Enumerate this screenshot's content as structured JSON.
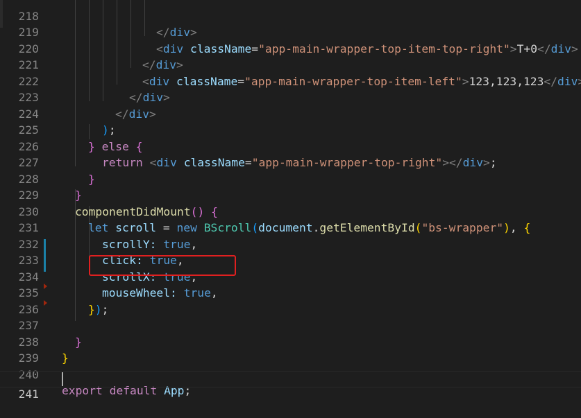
{
  "editor": {
    "lines": [
      {
        "num": "218",
        "tokens": [
          [
            "tok-punct",
            "</"
          ],
          [
            "tok-tag",
            "div"
          ],
          [
            "tok-punct",
            ">"
          ]
        ]
      },
      {
        "num": "219",
        "tokens": [
          [
            "tok-punct",
            "<"
          ],
          [
            "tok-tag",
            "div"
          ],
          [
            "tok-text",
            " "
          ],
          [
            "tok-attr",
            "className"
          ],
          [
            "tok-text",
            "="
          ],
          [
            "tok-str",
            "\"app-main-wrapper-top-item-top-right\""
          ],
          [
            "tok-punct",
            ">"
          ],
          [
            "tok-text",
            "T+0"
          ],
          [
            "tok-punct",
            "</"
          ],
          [
            "tok-tag",
            "div"
          ],
          [
            "tok-punct",
            ">"
          ]
        ]
      },
      {
        "num": "220",
        "tokens": [
          [
            "tok-punct",
            "</"
          ],
          [
            "tok-tag",
            "div"
          ],
          [
            "tok-punct",
            ">"
          ]
        ]
      },
      {
        "num": "221",
        "tokens": [
          [
            "tok-punct",
            "<"
          ],
          [
            "tok-tag",
            "div"
          ],
          [
            "tok-text",
            " "
          ],
          [
            "tok-attr",
            "className"
          ],
          [
            "tok-text",
            "="
          ],
          [
            "tok-str",
            "\"app-main-wrapper-top-item-left\""
          ],
          [
            "tok-punct",
            ">"
          ],
          [
            "tok-text",
            "123,123,123"
          ],
          [
            "tok-punct",
            "</"
          ],
          [
            "tok-tag",
            "div"
          ],
          [
            "tok-punct",
            ">"
          ]
        ]
      },
      {
        "num": "222",
        "tokens": [
          [
            "tok-punct",
            "</"
          ],
          [
            "tok-tag",
            "div"
          ],
          [
            "tok-punct",
            ">"
          ]
        ]
      },
      {
        "num": "223",
        "tokens": [
          [
            "tok-punct",
            "</"
          ],
          [
            "tok-tag",
            "div"
          ],
          [
            "tok-punct",
            ">"
          ]
        ]
      },
      {
        "num": "224",
        "tokens": [
          [
            "tok-br3",
            ")"
          ],
          [
            "tok-text",
            ";"
          ]
        ]
      },
      {
        "num": "225",
        "tokens": [
          [
            "tok-br2",
            "}"
          ],
          [
            "tok-text",
            " "
          ],
          [
            "tok-ctrl",
            "else"
          ],
          [
            "tok-text",
            " "
          ],
          [
            "tok-br2",
            "{"
          ]
        ]
      },
      {
        "num": "226",
        "tokens": [
          [
            "tok-ctrl",
            "return"
          ],
          [
            "tok-text",
            " "
          ],
          [
            "tok-punct",
            "<"
          ],
          [
            "tok-tag",
            "div"
          ],
          [
            "tok-text",
            " "
          ],
          [
            "tok-attr",
            "className"
          ],
          [
            "tok-text",
            "="
          ],
          [
            "tok-str",
            "\"app-main-wrapper-top-right\""
          ],
          [
            "tok-punct",
            "></"
          ],
          [
            "tok-tag",
            "div"
          ],
          [
            "tok-punct",
            ">"
          ],
          [
            "tok-text",
            ";"
          ]
        ]
      },
      {
        "num": "227",
        "tokens": [
          [
            "tok-br2",
            "}"
          ]
        ]
      },
      {
        "num": "228",
        "tokens": [
          [
            "tok-br2",
            "}"
          ]
        ]
      },
      {
        "num": "229",
        "tokens": [
          [
            "tok-fn",
            "componentDidMount"
          ],
          [
            "tok-br2",
            "()"
          ],
          [
            "tok-text",
            " "
          ],
          [
            "tok-br2",
            "{"
          ]
        ]
      },
      {
        "num": "230",
        "tokens": [
          [
            "tok-kw",
            "let"
          ],
          [
            "tok-text",
            " "
          ],
          [
            "tok-var",
            "scroll"
          ],
          [
            "tok-text",
            " = "
          ],
          [
            "tok-kw",
            "new"
          ],
          [
            "tok-text",
            " "
          ],
          [
            "tok-cls",
            "BScroll"
          ],
          [
            "tok-br3",
            "("
          ],
          [
            "tok-var",
            "document"
          ],
          [
            "tok-text",
            "."
          ],
          [
            "tok-fn",
            "getElementById"
          ],
          [
            "tok-br1",
            "("
          ],
          [
            "tok-str",
            "\"bs-wrapper\""
          ],
          [
            "tok-br1",
            ")"
          ],
          [
            "tok-text",
            ", "
          ],
          [
            "tok-br1",
            "{"
          ]
        ]
      },
      {
        "num": "231",
        "tokens": [
          [
            "tok-var",
            "scrollY"
          ],
          [
            "tok-var",
            ":"
          ],
          [
            "tok-text",
            " "
          ],
          [
            "tok-kw",
            "true"
          ],
          [
            "tok-text",
            ","
          ]
        ]
      },
      {
        "num": "232",
        "tokens": [
          [
            "tok-var",
            "click"
          ],
          [
            "tok-var",
            ":"
          ],
          [
            "tok-text",
            " "
          ],
          [
            "tok-kw",
            "true"
          ],
          [
            "tok-text",
            ","
          ]
        ]
      },
      {
        "num": "233",
        "tokens": [
          [
            "tok-var",
            "scrollX"
          ],
          [
            "tok-var",
            ":"
          ],
          [
            "tok-text",
            " "
          ],
          [
            "tok-kw",
            "true"
          ],
          [
            "tok-text",
            ","
          ]
        ]
      },
      {
        "num": "234",
        "tokens": [
          [
            "tok-var",
            "mouseWheel"
          ],
          [
            "tok-var",
            ":"
          ],
          [
            "tok-text",
            " "
          ],
          [
            "tok-kw",
            "true"
          ],
          [
            "tok-text",
            ","
          ]
        ]
      },
      {
        "num": "235",
        "tokens": [
          [
            "tok-br1",
            "}"
          ],
          [
            "tok-br3",
            ")"
          ],
          [
            "tok-text",
            ";"
          ]
        ]
      },
      {
        "num": "236",
        "tokens": []
      },
      {
        "num": "237",
        "tokens": [
          [
            "tok-br2",
            "}"
          ]
        ]
      },
      {
        "num": "238",
        "tokens": [
          [
            "tok-br1",
            "}"
          ]
        ]
      },
      {
        "num": "239",
        "tokens": []
      },
      {
        "num": "240",
        "tokens": [
          [
            "tok-ctrl",
            "export"
          ],
          [
            "tok-text",
            " "
          ],
          [
            "tok-ctrl",
            "default"
          ],
          [
            "tok-text",
            " "
          ],
          [
            "tok-var",
            "App"
          ],
          [
            "tok-text",
            ";"
          ]
        ]
      },
      {
        "num": "241",
        "tokens": []
      }
    ]
  },
  "colors": {
    "background": "#1e1e1e",
    "highlight_box": "#e02020",
    "git_modified": "#1b81a8",
    "git_deleted": "#a1260d"
  }
}
